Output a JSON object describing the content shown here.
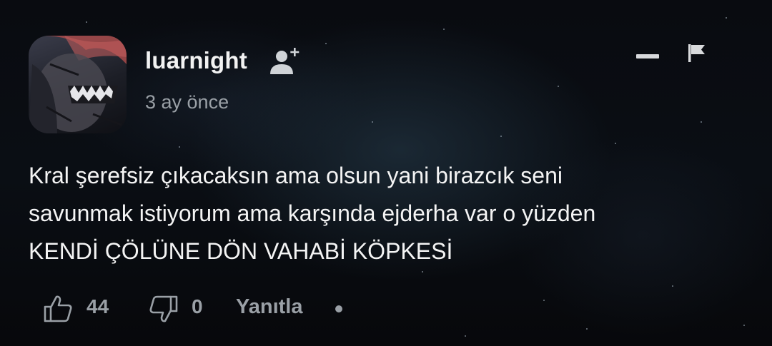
{
  "comment": {
    "username": "luarnight",
    "timestamp": "3 ay önce",
    "body_lines": [
      "Kral şerefsiz çıkacaksın ama olsun yani birazcık seni",
      "savunmak istiyorum ama karşında ejderha var o yüzden",
      "KENDİ ÇÖLÜNE DÖN VAHABİ KÖPKESİ"
    ],
    "likes": "44",
    "dislikes": "0",
    "reply_label": "Yanıtla"
  },
  "icons": {
    "follow": "add-user-icon",
    "collapse": "minus-icon",
    "report": "flag-icon",
    "like": "thumbs-up-icon",
    "dislike": "thumbs-down-icon",
    "more": "dot-icon"
  },
  "colors": {
    "background": "#07080c",
    "primary_text": "#f4f4f4",
    "secondary_text": "#9aa0a6"
  }
}
